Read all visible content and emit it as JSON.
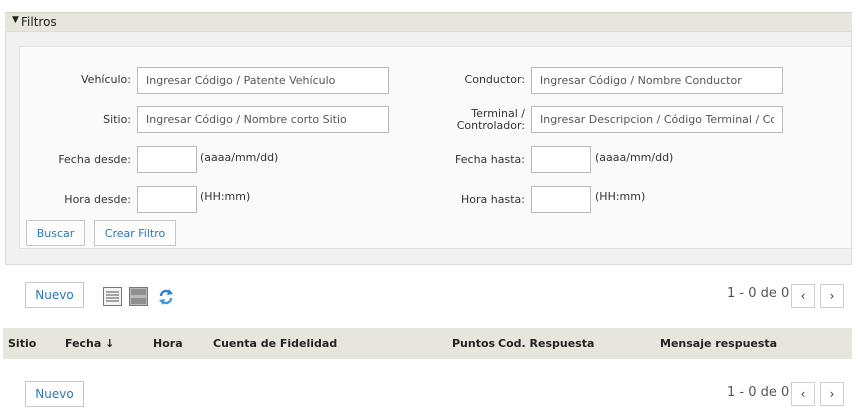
{
  "filters": {
    "title": "Filtros",
    "vehiculo": {
      "label": "Vehículo:",
      "placeholder": "Ingresar Código / Patente Vehículo",
      "value": ""
    },
    "conductor": {
      "label": "Conductor:",
      "placeholder": "Ingresar Código / Nombre Conductor",
      "value": ""
    },
    "sitio": {
      "label": "Sitio:",
      "placeholder": "Ingresar Código / Nombre corto Sitio",
      "value": ""
    },
    "terminal": {
      "label_line1": "Terminal /",
      "label_line2": "Controlador:",
      "placeholder": "Ingresar Descripcion / Código Terminal / Contro",
      "value": ""
    },
    "fecha_desde": {
      "label": "Fecha desde:",
      "hint": "(aaaa/mm/dd)",
      "value": ""
    },
    "fecha_hasta": {
      "label": "Fecha hasta:",
      "hint": "(aaaa/mm/dd)",
      "value": ""
    },
    "hora_desde": {
      "label": "Hora desde:",
      "hint": "(HH:mm)",
      "value": ""
    },
    "hora_hasta": {
      "label": "Hora hasta:",
      "hint": "(HH:mm)",
      "value": ""
    },
    "buscar_label": "Buscar",
    "crear_filtro_label": "Crear Filtro"
  },
  "toolbar_top": {
    "nuevo_label": "Nuevo",
    "pager_text": "1 - 0 de 0",
    "prev_label": "‹",
    "next_label": "›"
  },
  "grid": {
    "columns": [
      "Sitio",
      "Fecha ↓",
      "Hora",
      "Cuenta de Fidelidad",
      "Puntos",
      "Cod. Respuesta",
      "Mensaje respuesta"
    ],
    "rows": []
  },
  "toolbar_bottom": {
    "nuevo_label": "Nuevo",
    "pager_text": "1 - 0 de 0",
    "prev_label": "‹",
    "next_label": "›"
  },
  "colors": {
    "header_bg": "#e6e6dc",
    "panel_bg": "#f1f1f1",
    "link_blue": "#2a77b6"
  },
  "icons": [
    "triangle-down-icon",
    "list-view-icon",
    "compact-view-icon",
    "refresh-icon",
    "chevron-left-icon",
    "chevron-right-icon"
  ]
}
